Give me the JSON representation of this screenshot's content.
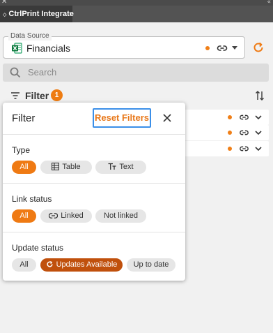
{
  "window": {
    "close_glyph": "✕",
    "collapse_glyph": "«",
    "tab_grip": "◇",
    "tab_label": "CtrlPrint Integrate"
  },
  "data_source": {
    "legend": "Data Source",
    "value": "Financials",
    "icon": "excel-icon",
    "status_color": "#f07f17"
  },
  "search": {
    "placeholder": "Search"
  },
  "filter_bar": {
    "label": "Filter",
    "count": "1"
  },
  "rows": [
    {
      "status": "dot"
    },
    {
      "status": "dot"
    },
    {
      "status": "dot"
    }
  ],
  "filter_popup": {
    "title": "Filter",
    "reset_label": "Reset Filters",
    "sections": [
      {
        "title": "Type",
        "options": [
          {
            "label": "All",
            "selected": true
          },
          {
            "label": "Table",
            "icon": "table-icon"
          },
          {
            "label": "Text",
            "icon": "text-icon"
          }
        ]
      },
      {
        "title": "Link status",
        "options": [
          {
            "label": "All",
            "selected": true
          },
          {
            "label": "Linked",
            "icon": "link-icon"
          },
          {
            "label": "Not linked"
          }
        ]
      },
      {
        "title": "Update status",
        "options": [
          {
            "label": "All"
          },
          {
            "label": "Updates Available",
            "icon": "refresh-icon",
            "selected": true
          },
          {
            "label": "Up to date"
          }
        ]
      }
    ]
  },
  "colors": {
    "accent": "#ef7a13",
    "accent_dark": "#c0500c",
    "focus": "#3b8fe8"
  }
}
